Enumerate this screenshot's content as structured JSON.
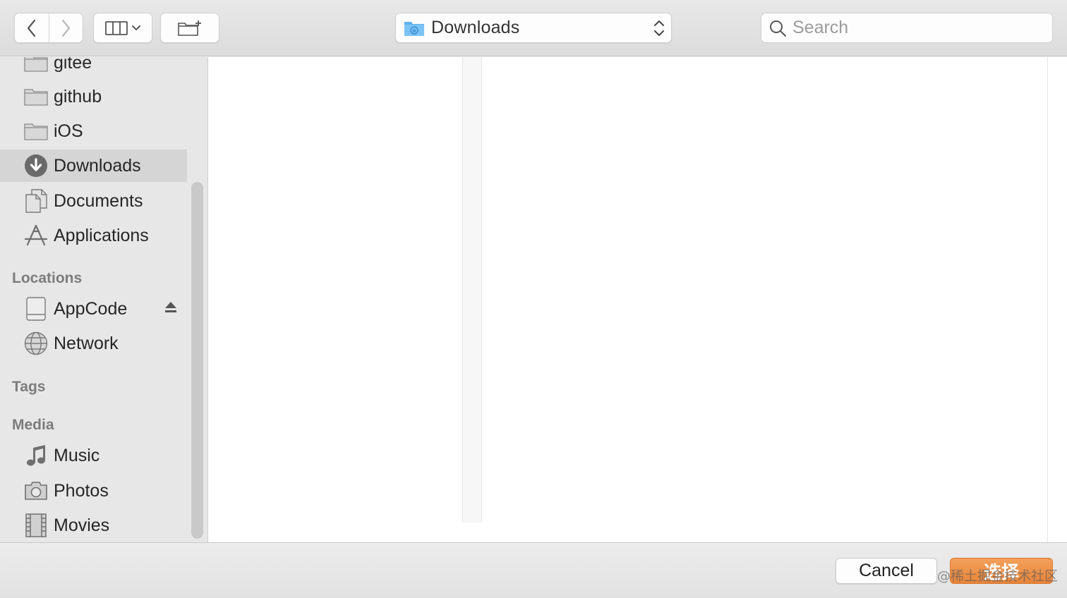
{
  "toolbar": {
    "location": "Downloads",
    "search_placeholder": "Search"
  },
  "sidebar": {
    "favorites": [
      {
        "label": "gitee",
        "icon": "folder-icon"
      },
      {
        "label": "github",
        "icon": "folder-icon"
      },
      {
        "label": "iOS",
        "icon": "folder-icon"
      },
      {
        "label": "Downloads",
        "icon": "downloads-icon",
        "selected": true
      },
      {
        "label": "Documents",
        "icon": "documents-icon"
      },
      {
        "label": "Applications",
        "icon": "applications-icon"
      }
    ],
    "locations_header": "Locations",
    "locations": [
      {
        "label": "AppCode",
        "icon": "drive-icon",
        "ejectable": true
      },
      {
        "label": "Network",
        "icon": "network-icon"
      }
    ],
    "tags_header": "Tags",
    "media_header": "Media",
    "media": [
      {
        "label": "Music",
        "icon": "music-icon"
      },
      {
        "label": "Photos",
        "icon": "camera-icon"
      },
      {
        "label": "Movies",
        "icon": "film-icon"
      }
    ]
  },
  "footer": {
    "cancel_label": "Cancel",
    "choose_label": "选择",
    "watermark": "@稀土掘金技术社区"
  },
  "colors": {
    "accent_button": "#e8853a",
    "selection": "#d5d5d5",
    "folder_blue": "#5fb0ee"
  }
}
